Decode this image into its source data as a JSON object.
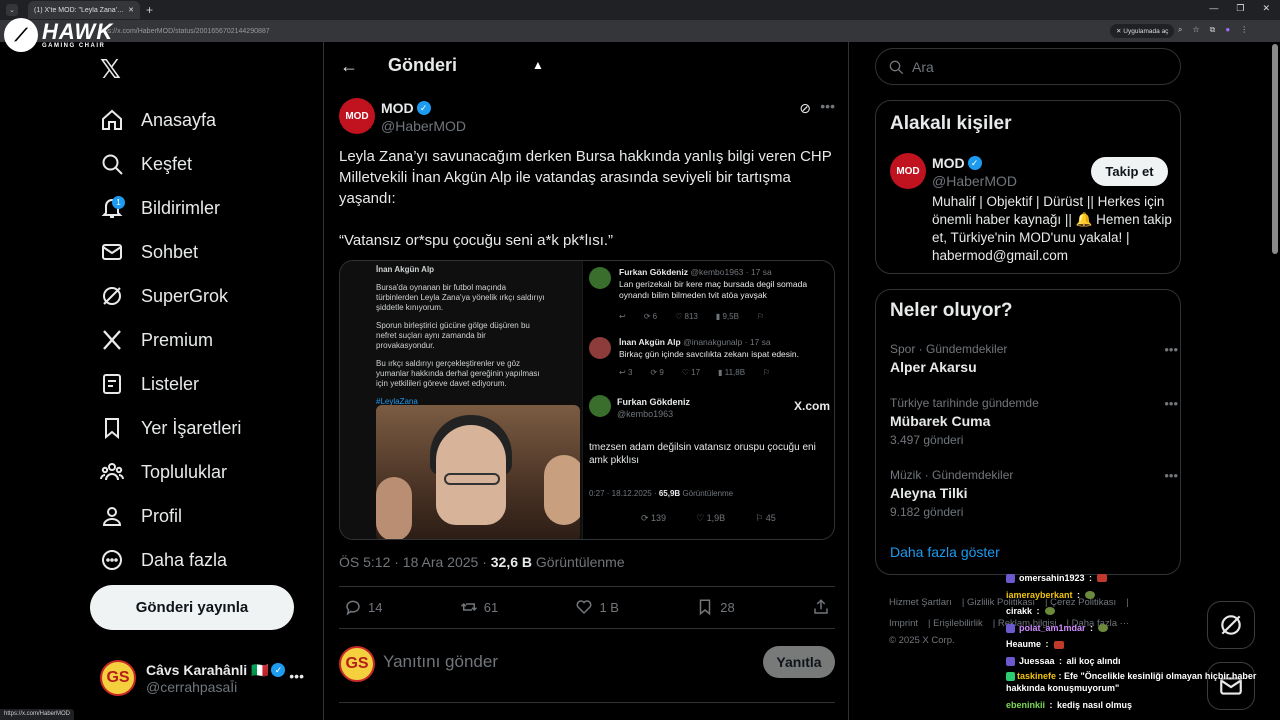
{
  "browser": {
    "tab_title": "(1) X'te MOD: \"Leyla Zana'yı sa",
    "url": "ttps://x.com/HaberMOD/status/2001656702144290887",
    "app_button": "Uygulamada aç",
    "status_url": "https://x.com/HaberMOD"
  },
  "overlay_logo": {
    "brand": "HAWK",
    "tagline": "GAMING CHAIR"
  },
  "nav": {
    "items": [
      {
        "label": "Anasayfa",
        "icon": "home-icon"
      },
      {
        "label": "Keşfet",
        "icon": "search-icon"
      },
      {
        "label": "Bildirimler",
        "icon": "bell-icon",
        "badge": "1"
      },
      {
        "label": "Sohbet",
        "icon": "mail-icon"
      },
      {
        "label": "SuperGrok",
        "icon": "grok-icon"
      },
      {
        "label": "Premium",
        "icon": "x-icon"
      },
      {
        "label": "Listeler",
        "icon": "list-icon"
      },
      {
        "label": "Yer İşaretleri",
        "icon": "bookmark-icon"
      },
      {
        "label": "Topluluklar",
        "icon": "communities-icon"
      },
      {
        "label": "Profil",
        "icon": "profile-icon"
      },
      {
        "label": "Daha fazla",
        "icon": "more-circle-icon"
      }
    ],
    "post_button": "Gönderi yayınla"
  },
  "account": {
    "name": "Câvs Karahânli 🇮🇹",
    "handle": "@cerrahpasaĪi"
  },
  "post": {
    "header_title": "Gönderi",
    "author_name": "MOD",
    "author_handle": "@HaberMOD",
    "avatar_text": "MOD",
    "text_p1": "Leyla Zana’yı savunacağım derken Bursa hakkında yanlış bilgi veren CHP Milletvekili İnan Akgün Alp ile vatandaş arasında seviyeli bir tartışma yaşandı:",
    "text_p2": "“Vatansız or*spu çocuğu seni a*k pk*lısı.”",
    "time": "ÖS 5:12 · 18 Ara 2025 ·",
    "views": "32,6 B",
    "views_label": "Görüntülenme",
    "replies": "14",
    "reposts": "61",
    "likes": "1 B",
    "bookmarks": "28",
    "reply_placeholder": "Yanıtını gönder",
    "reply_button": "Yanıtla"
  },
  "media": {
    "left_header": "İnan Akgün Alp",
    "left_p1": "Bursa'da oynanan bir futbol maçında türbinlerden Leyla Zana'ya yönelik ırkçı saldırıyı şiddetle kınıyorum.",
    "left_p2": "Sporun birleştirici gücüne gölge düşüren bu nefret suçları aynı zamanda bir provakasyondur.",
    "left_p3": "Bu ırkçı saldırıyı gerçekleştirenler ve göz yumanlar hakkında derhal gereğinin yapılması için yetkilileri göreve davet ediyorum.",
    "left_tag": "#LeylaZana",
    "reply1_name": "Furkan Gökdeniz",
    "reply1_meta": "@kembo1963 · 17 sa",
    "reply1_text": "Lan gerizekalı bir kere maç bursada degil somada oynandı bilim bilmeden tvit atöa yavşak",
    "reply1_stats": [
      "",
      "6",
      "813",
      "9,5B"
    ],
    "reply2_name": "İnan Akgün Alp",
    "reply2_meta": "@inanakgunalp · 17 sa",
    "reply2_text": "Birkaç gün içinde savcılıkta zekanı ispat edesin.",
    "reply2_stats": [
      "3",
      "9",
      "17",
      "11,8B"
    ],
    "quote_name": "Furkan Gökdeniz",
    "quote_handle": "@kembo1963",
    "quote_brand": "X.com",
    "quote_text": "tmezsen adam değilsin vatansız oruspu çocuğu eni amk pkklısı",
    "quote_time": "0:27 · 18.12.2025 ·",
    "quote_views": "65,9B",
    "quote_views_label": "Görüntülenme",
    "quote_stats": [
      "139",
      "1,9B",
      "45"
    ]
  },
  "search": {
    "placeholder": "Ara"
  },
  "related": {
    "title": "Alakalı kişiler",
    "name": "MOD",
    "handle": "@HaberMOD",
    "follow": "Takip et",
    "bio": "Muhalif | Objektif | Dürüst || Herkes için önemli haber kaynağı || 🔔 Hemen takip et, Türkiye'nin MOD'unu yakala! | habermod@gmail.com"
  },
  "trends": {
    "title": "Neler oluyor?",
    "items": [
      {
        "context": "Spor · Gündemdekiler",
        "title": "Alper Akarsu",
        "count": ""
      },
      {
        "context": "Türkiye tarihinde gündemde",
        "title": "Mübarek Cuma",
        "count": "3.497 gönderi"
      },
      {
        "context": "Müzik · Gündemdekiler",
        "title": "Aleyna Tilki",
        "count": "9.182 gönderi"
      }
    ],
    "show_more": "Daha fazla göster"
  },
  "footer": {
    "row1": [
      "Hizmet Şartları",
      "Gizlilik Politikası",
      "Çerez Politikası"
    ],
    "row2": [
      "Imprint",
      "Erişilebilirlik",
      "Reklam bilgisi",
      "Daha fazla ···"
    ],
    "copyright": "© 2025 X Corp."
  },
  "chat": [
    {
      "user": "omersahin1923",
      "msg": "",
      "color": "#ffffff"
    },
    {
      "user": "iamerayberkant",
      "msg": "",
      "color": "#f1c40f"
    },
    {
      "user": "cirakk",
      "msg": "",
      "color": "#ffffff"
    },
    {
      "user": "polat_am1mdar",
      "msg": "",
      "color": "#d08cff"
    },
    {
      "user": "Heaume",
      "msg": "",
      "color": "#ffffff"
    },
    {
      "user": "Juessaa",
      "msg": "ali koç alındı",
      "color": "#ffffff"
    },
    {
      "user": "taskinefe",
      "msg": "Efe \"Öncelikle kesinliği olmayan hiçbir haber hakkında konuşmuyorum\"",
      "color": "#f1c40f"
    },
    {
      "user": "ebeninkii",
      "msg": "kediş nasıl olmuş",
      "color": "#7ed957"
    }
  ]
}
